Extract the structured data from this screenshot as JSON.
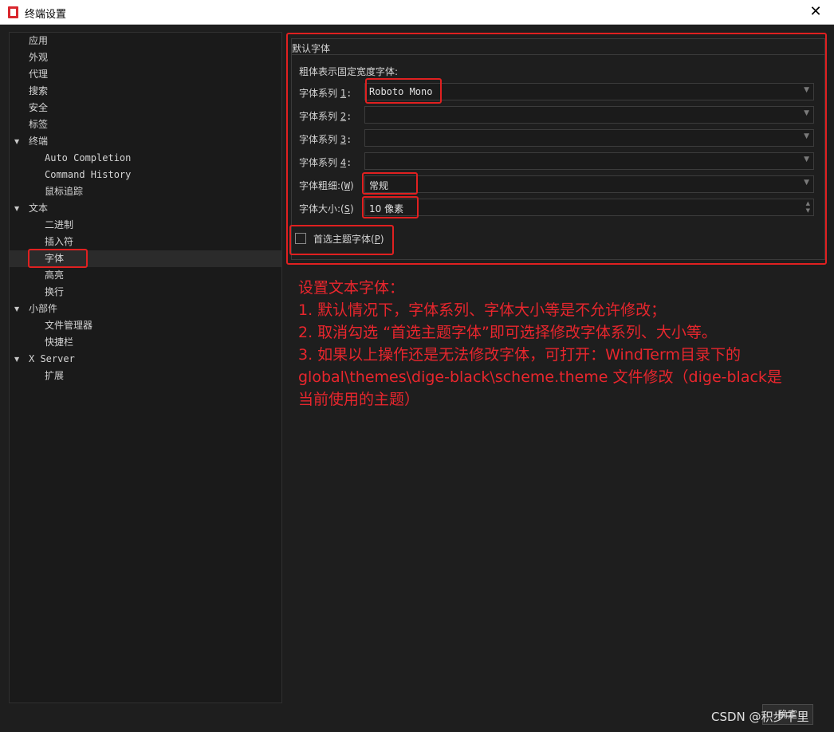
{
  "window": {
    "title": "终端设置",
    "close_glyph": "✕",
    "app_icon": "windterm-app-icon"
  },
  "tree": [
    {
      "label": "应用",
      "level": 0
    },
    {
      "label": "外观",
      "level": 0
    },
    {
      "label": "代理",
      "level": 0
    },
    {
      "label": "搜索",
      "level": 0
    },
    {
      "label": "安全",
      "level": 0
    },
    {
      "label": "标签",
      "level": 0
    },
    {
      "label": "终端",
      "level": 0,
      "expanded": true
    },
    {
      "label": "Auto Completion",
      "level": 1
    },
    {
      "label": "Command History",
      "level": 1
    },
    {
      "label": "鼠标追踪",
      "level": 1
    },
    {
      "label": "文本",
      "level": 0,
      "expanded": true
    },
    {
      "label": "二进制",
      "level": 1
    },
    {
      "label": "插入符",
      "level": 1
    },
    {
      "label": "字体",
      "level": 1,
      "selected": true
    },
    {
      "label": "高亮",
      "level": 1
    },
    {
      "label": "换行",
      "level": 1
    },
    {
      "label": "小部件",
      "level": 0,
      "expanded": true
    },
    {
      "label": "文件管理器",
      "level": 1
    },
    {
      "label": "快捷栏",
      "level": 1
    },
    {
      "label": "X Server",
      "level": 0,
      "expanded": true
    },
    {
      "label": "扩展",
      "level": 1
    }
  ],
  "font_settings": {
    "group_title": "默认字体",
    "subgroup_title": "粗体表示固定宽度字体:",
    "family_label": "字体系列",
    "family_rows": [
      {
        "num": "1",
        "value": "Roboto Mono"
      },
      {
        "num": "2",
        "value": ""
      },
      {
        "num": "3",
        "value": ""
      },
      {
        "num": "4",
        "value": ""
      }
    ],
    "weight_label_pre": "字体粗细:(",
    "weight_key": "W",
    "weight_label_post": ")",
    "weight_value": "常规",
    "size_label_pre": "字体大小:(",
    "size_key": "S",
    "size_label_post": ")",
    "size_value": "10 像素",
    "prefer_theme_pre": "首选主题字体(",
    "prefer_theme_key": "P",
    "prefer_theme_post": ")",
    "prefer_theme_checked": false
  },
  "annotation": [
    "设置文本字体：",
    "1. 默认情况下，字体系列、字体大小等是不允许修改；",
    "2. 取消勾选 “首选主题字体”即可选择修改字体系列、大小等。",
    "3. 如果以上操作还是无法修改字体，可打开：WindTerm目录下的",
    "global\\themes\\dige-black\\scheme.theme 文件修改（dige-black是",
    "当前使用的主题）"
  ],
  "annotation_color": "#e8262d",
  "ok_button": "确定",
  "watermark": "CSDN @积步千里"
}
